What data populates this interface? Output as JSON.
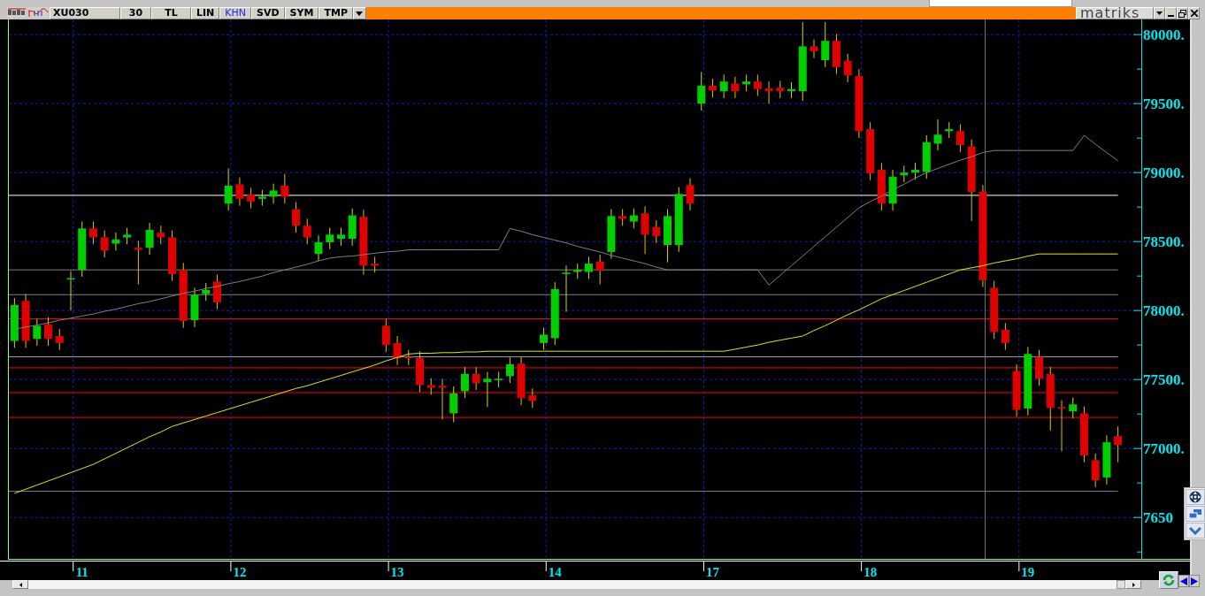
{
  "toolbar": {
    "symbol": "XU030",
    "buttons": [
      {
        "label": "30",
        "selected": false
      },
      {
        "label": "TL",
        "selected": false
      },
      {
        "label": "LIN",
        "selected": false
      },
      {
        "label": "KHN",
        "selected": true
      },
      {
        "label": "SVD",
        "selected": false
      },
      {
        "label": "SYM",
        "selected": false
      },
      {
        "label": "TMP",
        "selected": false
      }
    ],
    "logo": "matriks"
  },
  "chart": {
    "covered_axis_label": "7650",
    "chart_data": {
      "type": "candlestick",
      "ylim": [
        76200,
        80110
      ],
      "grid": true,
      "categories": [
        null,
        null,
        null,
        null,
        null,
        null,
        "11",
        null,
        null,
        null,
        null,
        null,
        null,
        null,
        null,
        null,
        null,
        null,
        null,
        null,
        "12",
        null,
        null,
        null,
        null,
        null,
        null,
        null,
        null,
        null,
        null,
        null,
        null,
        null,
        "13",
        null,
        null,
        null,
        null,
        null,
        null,
        null,
        null,
        null,
        null,
        null,
        null,
        null,
        "14",
        null,
        null,
        null,
        null,
        null,
        null,
        null,
        null,
        null,
        null,
        null,
        null,
        null,
        "17",
        null,
        null,
        null,
        null,
        null,
        null,
        null,
        null,
        null,
        null,
        null,
        null,
        null,
        "18",
        null,
        null,
        null,
        null,
        null,
        null,
        null,
        null,
        null,
        null,
        null,
        null,
        null,
        "19",
        null,
        null,
        null,
        null,
        null,
        null,
        null,
        null
      ],
      "yticks": [
        {
          "value": 80000,
          "label": "80000."
        },
        {
          "value": 79500,
          "label": "79500."
        },
        {
          "value": 79000,
          "label": "79000."
        },
        {
          "value": 78500,
          "label": "78500."
        },
        {
          "value": 78000,
          "label": "78000."
        },
        {
          "value": 77500,
          "label": "77500."
        },
        {
          "value": 77000,
          "label": "77000."
        }
      ],
      "series": [
        {
          "type": "line",
          "color": "#e8e800",
          "values": [
            76675,
            76705,
            76735,
            76765,
            76795,
            76825,
            76855,
            76885,
            76925,
            76965,
            77005,
            77045,
            77085,
            77120,
            77160,
            77185,
            77210,
            77235,
            77260,
            77285,
            77310,
            77335,
            77360,
            77385,
            77410,
            77435,
            77455,
            77480,
            77505,
            77530,
            77555,
            77580,
            77605,
            77635,
            77660,
            77685,
            77690,
            77690,
            77695,
            77695,
            77700,
            77700,
            77705,
            77705,
            77705,
            77705,
            77705,
            77705,
            77705,
            77705,
            77705,
            77705,
            77705,
            77705,
            77705,
            77705,
            77705,
            77705,
            77705,
            77705,
            77705,
            77705,
            77705,
            77705,
            77720,
            77735,
            77750,
            77770,
            77785,
            77800,
            77815,
            77855,
            77890,
            77930,
            77970,
            78005,
            78045,
            78085,
            78115,
            78145,
            78175,
            78205,
            78235,
            78265,
            78295,
            78310,
            78325,
            78345,
            78360,
            78375,
            78395,
            78410,
            78410,
            78410,
            78410,
            78410,
            78410,
            78410,
            78410
          ]
        },
        {
          "type": "line",
          "color": "#808080",
          "values": [
            77865,
            77880,
            77895,
            77910,
            77930,
            77945,
            77960,
            77975,
            77995,
            78010,
            78030,
            78050,
            78065,
            78085,
            78105,
            78125,
            78140,
            78160,
            78175,
            78195,
            78210,
            78230,
            78250,
            78275,
            78295,
            78315,
            78335,
            78360,
            78380,
            78390,
            78395,
            78405,
            78415,
            78425,
            78430,
            78440,
            78440,
            78440,
            78440,
            78440,
            78440,
            78440,
            78440,
            78440,
            78595,
            78575,
            78550,
            78530,
            78510,
            78490,
            78465,
            78445,
            78425,
            78400,
            78380,
            78360,
            78340,
            78315,
            78295,
            78295,
            78295,
            78295,
            78295,
            78295,
            78295,
            78295,
            78295,
            78185,
            78255,
            78325,
            78395,
            78465,
            78535,
            78605,
            78675,
            78745,
            78790,
            78830,
            78875,
            78915,
            78960,
            79000,
            79030,
            79060,
            79090,
            79115,
            79145,
            79160,
            79160,
            79160,
            79160,
            79160,
            79160,
            79160,
            79160,
            79270,
            79205,
            79145,
            79085
          ]
        }
      ],
      "ref_lines": [
        {
          "axis": "y",
          "value": 78835,
          "color": "#ffffff"
        },
        {
          "axis": "y",
          "value": 78295,
          "color": "#808080"
        },
        {
          "axis": "y",
          "value": 78115,
          "color": "#808080"
        },
        {
          "axis": "y",
          "value": 77940,
          "color": "#ff0000"
        },
        {
          "axis": "y",
          "value": 77665,
          "color": "#a0a0a0"
        },
        {
          "axis": "y",
          "value": 77585,
          "color": "#ff0000"
        },
        {
          "axis": "y",
          "value": 77405,
          "color": "#ff0000"
        },
        {
          "axis": "y",
          "value": 77225,
          "color": "#ff0000"
        },
        {
          "axis": "y",
          "value": 76690,
          "color": "#808080"
        }
      ],
      "ohlc": [
        [
          77780,
          78090,
          77730,
          78040
        ],
        [
          78070,
          78120,
          77730,
          77780
        ],
        [
          77795,
          77940,
          77745,
          77890
        ],
        [
          77900,
          77950,
          77745,
          77795
        ],
        [
          77815,
          77865,
          77715,
          77765
        ],
        [
          78225,
          78285,
          78000,
          78235
        ],
        [
          78295,
          78645,
          78245,
          78595
        ],
        [
          78595,
          78645,
          78480,
          78530
        ],
        [
          78530,
          78580,
          78385,
          78435
        ],
        [
          78485,
          78565,
          78435,
          78515
        ],
        [
          78530,
          78600,
          78480,
          78550
        ],
        [
          78455,
          78505,
          78190,
          78440
        ],
        [
          78455,
          78635,
          78405,
          78585
        ],
        [
          78565,
          78615,
          78480,
          78530
        ],
        [
          78530,
          78580,
          78215,
          78265
        ],
        [
          78295,
          78345,
          77875,
          77925
        ],
        [
          77930,
          78165,
          77880,
          78115
        ],
        [
          78120,
          78200,
          78070,
          78150
        ],
        [
          78210,
          78260,
          78010,
          78060
        ],
        [
          78775,
          79030,
          78725,
          78905
        ],
        [
          78915,
          78965,
          78760,
          78810
        ],
        [
          78840,
          78890,
          78740,
          78790
        ],
        [
          78810,
          78875,
          78760,
          78825
        ],
        [
          78825,
          78920,
          78775,
          78870
        ],
        [
          78905,
          78990,
          78775,
          78825
        ],
        [
          78735,
          78785,
          78565,
          78615
        ],
        [
          78615,
          78665,
          78480,
          78530
        ],
        [
          78410,
          78545,
          78360,
          78495
        ],
        [
          78495,
          78600,
          78445,
          78550
        ],
        [
          78520,
          78600,
          78470,
          78550
        ],
        [
          78520,
          78740,
          78470,
          78690
        ],
        [
          78680,
          78730,
          78260,
          78325
        ],
        [
          78340,
          78390,
          78275,
          78325
        ],
        [
          77890,
          77940,
          77700,
          77750
        ],
        [
          77765,
          77815,
          77605,
          77655
        ],
        [
          77665,
          77715,
          77605,
          77655
        ],
        [
          77655,
          77705,
          77410,
          77460
        ],
        [
          77460,
          77510,
          77390,
          77440
        ],
        [
          77455,
          77505,
          77210,
          77440
        ],
        [
          77255,
          77450,
          77190,
          77400
        ],
        [
          77415,
          77590,
          77365,
          77540
        ],
        [
          77540,
          77590,
          77425,
          77475
        ],
        [
          77480,
          77555,
          77300,
          77505
        ],
        [
          77495,
          77555,
          77445,
          77505
        ],
        [
          77525,
          77660,
          77475,
          77610
        ],
        [
          77615,
          77665,
          77315,
          77365
        ],
        [
          77385,
          77435,
          77295,
          77345
        ],
        [
          77765,
          77875,
          77715,
          77825
        ],
        [
          77800,
          78205,
          77750,
          78155
        ],
        [
          78265,
          78325,
          77990,
          78275
        ],
        [
          78280,
          78340,
          78230,
          78295
        ],
        [
          78280,
          78390,
          78230,
          78340
        ],
        [
          78355,
          78405,
          78190,
          78290
        ],
        [
          78425,
          78735,
          78375,
          78685
        ],
        [
          78685,
          78735,
          78615,
          78665
        ],
        [
          78645,
          78740,
          78595,
          78690
        ],
        [
          78705,
          78755,
          78410,
          78550
        ],
        [
          78605,
          78655,
          78490,
          78540
        ],
        [
          78475,
          78735,
          78350,
          78685
        ],
        [
          78475,
          78895,
          78425,
          78845
        ],
        [
          78910,
          78960,
          78725,
          78775
        ],
        [
          79500,
          79730,
          79450,
          79630
        ],
        [
          79630,
          79680,
          79545,
          79595
        ],
        [
          79590,
          79710,
          79540,
          79660
        ],
        [
          79645,
          79695,
          79540,
          79590
        ],
        [
          79640,
          79710,
          79590,
          79660
        ],
        [
          79660,
          79710,
          79555,
          79605
        ],
        [
          79610,
          79660,
          79500,
          79590
        ],
        [
          79615,
          79665,
          79540,
          79590
        ],
        [
          79590,
          79655,
          79540,
          79605
        ],
        [
          79590,
          80090,
          79520,
          79915
        ],
        [
          79915,
          79965,
          79830,
          79880
        ],
        [
          79815,
          80090,
          79765,
          79955
        ],
        [
          79955,
          80005,
          79715,
          79765
        ],
        [
          79810,
          79860,
          79655,
          79705
        ],
        [
          79700,
          79750,
          79250,
          79300
        ],
        [
          79315,
          79365,
          78945,
          78995
        ],
        [
          79020,
          79070,
          78725,
          78775
        ],
        [
          78775,
          79020,
          78725,
          78970
        ],
        [
          78980,
          79050,
          78930,
          79000
        ],
        [
          79000,
          79070,
          78950,
          79020
        ],
        [
          79005,
          79270,
          78955,
          79220
        ],
        [
          79210,
          79385,
          79160,
          79275
        ],
        [
          79300,
          79365,
          79250,
          79315
        ],
        [
          79300,
          79350,
          79150,
          79200
        ],
        [
          79190,
          79240,
          78650,
          78860
        ],
        [
          78860,
          78910,
          78170,
          78220
        ],
        [
          78165,
          78215,
          77795,
          77845
        ],
        [
          77860,
          77910,
          77715,
          77765
        ],
        [
          77560,
          77610,
          77230,
          77280
        ],
        [
          77290,
          77735,
          77240,
          77685
        ],
        [
          77665,
          77715,
          77455,
          77505
        ],
        [
          77540,
          77590,
          77130,
          77295
        ],
        [
          77300,
          77350,
          76980,
          77290
        ],
        [
          77270,
          77370,
          77220,
          77320
        ],
        [
          77255,
          77305,
          76900,
          76950
        ],
        [
          76915,
          76965,
          76720,
          76770
        ],
        [
          76790,
          77095,
          76740,
          77045
        ],
        [
          77090,
          77160,
          76900,
          77025
        ]
      ]
    }
  }
}
